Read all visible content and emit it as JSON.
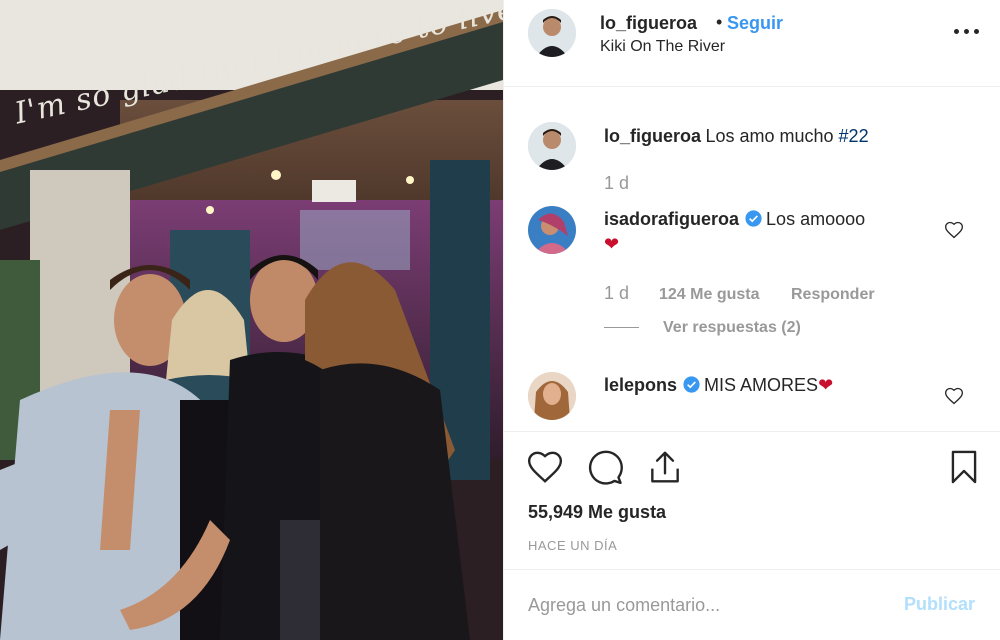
{
  "post": {
    "photo_alt": "Four people posing together at night outside a restaurant",
    "chalkboard_text": "I'm so glad that I'm here to live!"
  },
  "header": {
    "username": "lo_figueroa",
    "separator": "•",
    "follow_label": "Seguir",
    "location": "Kiki On The River",
    "more_icon": "more-options-icon"
  },
  "comments": [
    {
      "username": "lo_figueroa",
      "text": "Los amo mucho ",
      "hashtag": "#22",
      "time": "1 d"
    },
    {
      "username": "isadorafigueroa",
      "verified": true,
      "text": "Los amoooo",
      "emoji": "❤",
      "time": "1 d",
      "likes": "124 Me gusta",
      "reply_label": "Responder",
      "view_replies": "Ver respuestas (2)"
    },
    {
      "username": "lelepons",
      "verified": true,
      "text": "MIS AMORES",
      "emoji": "❤"
    }
  ],
  "actions": {
    "like_icon": "heart-icon",
    "comment_icon": "comment-icon",
    "share_icon": "share-icon",
    "save_icon": "bookmark-icon",
    "likes_count": "55,949 Me gusta",
    "posted_time": "Hace un día"
  },
  "add_comment": {
    "placeholder": "Agrega un comentario...",
    "publish_label": "Publicar"
  },
  "colors": {
    "link_blue": "#3897f0",
    "publish_disabled": "#b2dffc",
    "verified_blue": "#3897f0",
    "emoji_red": "#c8102e",
    "muted_text": "#999999"
  }
}
